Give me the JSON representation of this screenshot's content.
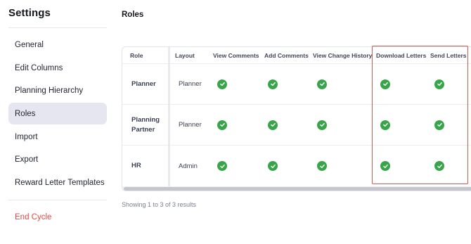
{
  "sidebar": {
    "title": "Settings",
    "items": [
      {
        "label": "General"
      },
      {
        "label": "Edit Columns"
      },
      {
        "label": "Planning Hierarchy"
      },
      {
        "label": "Roles"
      },
      {
        "label": "Import"
      },
      {
        "label": "Export"
      },
      {
        "label": "Reward Letter Templates"
      }
    ],
    "end_cycle_label": "End Cycle"
  },
  "main": {
    "title": "Roles",
    "table": {
      "columns": [
        "Role",
        "Layout",
        "View Comments",
        "Add Comments",
        "View Change History",
        "Download Letters",
        "Send Letters"
      ],
      "rows": [
        {
          "role_lines": [
            "Planner"
          ],
          "layout": "Planner",
          "permissions": [
            true,
            true,
            true,
            true,
            true
          ]
        },
        {
          "role_lines": [
            "Planning",
            "Partner"
          ],
          "layout": "Planner",
          "permissions": [
            true,
            true,
            true,
            true,
            true
          ]
        },
        {
          "role_lines": [
            "HR"
          ],
          "layout": "Admin",
          "permissions": [
            true,
            true,
            true,
            true,
            true
          ]
        }
      ]
    },
    "results_text": "Showing 1 to 3 of 3 results"
  },
  "colors": {
    "accent_active_bg": "#e6e6f1",
    "check_green": "#38a54a",
    "highlight_red": "#e2574c",
    "danger_text": "#e5483f"
  },
  "icons": {
    "permission": "check-circle-icon"
  }
}
